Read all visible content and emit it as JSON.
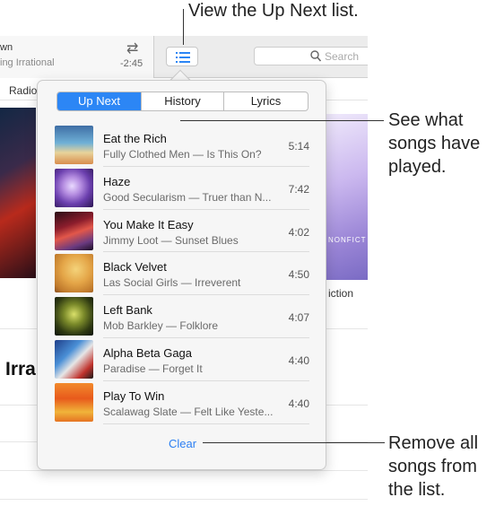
{
  "toolbar": {
    "now_playing_title": "wn",
    "now_playing_subtitle": "ing Irrational",
    "time_remaining": "-2:45",
    "search_placeholder": "Search",
    "nav_item": "Radio"
  },
  "background": {
    "artist_heading": "Irra",
    "album_label": "iction",
    "album_cover_text": "NONFICT"
  },
  "popover": {
    "tabs": [
      {
        "label": "Up Next",
        "selected": true
      },
      {
        "label": "History",
        "selected": false
      },
      {
        "label": "Lyrics",
        "selected": false
      }
    ],
    "songs": [
      {
        "title": "Eat the Rich",
        "subtitle": "Fully Clothed Men — Is This On?",
        "duration": "5:14"
      },
      {
        "title": "Haze",
        "subtitle": "Good Secularism — Truer than N...",
        "duration": "7:42"
      },
      {
        "title": "You Make It Easy",
        "subtitle": "Jimmy Loot — Sunset Blues",
        "duration": "4:02"
      },
      {
        "title": "Black Velvet",
        "subtitle": "Las Social Girls — Irreverent",
        "duration": "4:50"
      },
      {
        "title": "Left Bank",
        "subtitle": "Mob Barkley — Folklore",
        "duration": "4:07"
      },
      {
        "title": "Alpha Beta Gaga",
        "subtitle": "Paradise — Forget It",
        "duration": "4:40"
      },
      {
        "title": "Play To Win",
        "subtitle": "Scalawag Slate — Felt Like Yeste...",
        "duration": "4:40"
      }
    ],
    "clear_label": "Clear"
  },
  "callouts": {
    "upnext": "View the Up Next list.",
    "history": "See what songs have played.",
    "clear": "Remove all songs from the list."
  },
  "colors": {
    "accent": "#2c86f5",
    "link": "#2b7ff2"
  },
  "icons": {
    "repeat": "repeat-icon",
    "up_next": "up-next-list-icon",
    "search": "search-icon"
  }
}
